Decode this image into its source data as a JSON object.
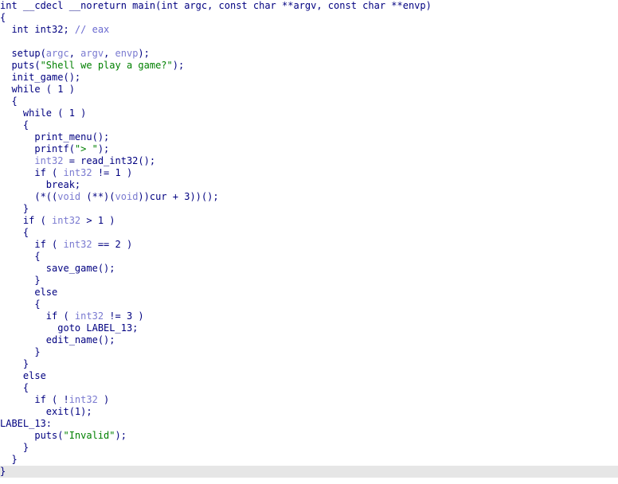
{
  "decompiler": {
    "lines": [
      [
        {
          "t": "int __cdecl __noreturn main(int argc, const char **argv, const char **envp)",
          "c": "code"
        }
      ],
      [
        {
          "t": "{",
          "c": "code"
        }
      ],
      [
        {
          "t": "  int int32; ",
          "c": "code"
        },
        {
          "t": "// eax",
          "c": "comment"
        }
      ],
      [
        {
          "t": "",
          "c": "code"
        }
      ],
      [
        {
          "t": "  setup(",
          "c": "code"
        },
        {
          "t": "argc",
          "c": "var"
        },
        {
          "t": ", ",
          "c": "code"
        },
        {
          "t": "argv",
          "c": "var"
        },
        {
          "t": ", ",
          "c": "code"
        },
        {
          "t": "envp",
          "c": "var"
        },
        {
          "t": ");",
          "c": "code"
        }
      ],
      [
        {
          "t": "  puts(",
          "c": "code"
        },
        {
          "t": "\"Shell we play a game?\"",
          "c": "string"
        },
        {
          "t": ");",
          "c": "code"
        }
      ],
      [
        {
          "t": "  init_game();",
          "c": "code"
        }
      ],
      [
        {
          "t": "  while ( 1 )",
          "c": "code"
        }
      ],
      [
        {
          "t": "  {",
          "c": "code"
        }
      ],
      [
        {
          "t": "    while ( 1 )",
          "c": "code"
        }
      ],
      [
        {
          "t": "    {",
          "c": "code"
        }
      ],
      [
        {
          "t": "      print_menu();",
          "c": "code"
        }
      ],
      [
        {
          "t": "      printf(",
          "c": "code"
        },
        {
          "t": "\"> \"",
          "c": "string"
        },
        {
          "t": ");",
          "c": "code"
        }
      ],
      [
        {
          "t": "      ",
          "c": "code"
        },
        {
          "t": "int32",
          "c": "var"
        },
        {
          "t": " = read_int32();",
          "c": "code"
        }
      ],
      [
        {
          "t": "      if ( ",
          "c": "code"
        },
        {
          "t": "int32",
          "c": "var"
        },
        {
          "t": " != 1 )",
          "c": "code"
        }
      ],
      [
        {
          "t": "        break;",
          "c": "code"
        }
      ],
      [
        {
          "t": "      (*((",
          "c": "code"
        },
        {
          "t": "void",
          "c": "var"
        },
        {
          "t": " (**)(",
          "c": "code"
        },
        {
          "t": "void",
          "c": "var"
        },
        {
          "t": "))cur + 3))();",
          "c": "code"
        }
      ],
      [
        {
          "t": "    }",
          "c": "code"
        }
      ],
      [
        {
          "t": "    if ( ",
          "c": "code"
        },
        {
          "t": "int32",
          "c": "var"
        },
        {
          "t": " > 1 )",
          "c": "code"
        }
      ],
      [
        {
          "t": "    {",
          "c": "code"
        }
      ],
      [
        {
          "t": "      if ( ",
          "c": "code"
        },
        {
          "t": "int32",
          "c": "var"
        },
        {
          "t": " == 2 )",
          "c": "code"
        }
      ],
      [
        {
          "t": "      {",
          "c": "code"
        }
      ],
      [
        {
          "t": "        save_game();",
          "c": "code"
        }
      ],
      [
        {
          "t": "      }",
          "c": "code"
        }
      ],
      [
        {
          "t": "      else",
          "c": "code"
        }
      ],
      [
        {
          "t": "      {",
          "c": "code"
        }
      ],
      [
        {
          "t": "        if ( ",
          "c": "code"
        },
        {
          "t": "int32",
          "c": "var"
        },
        {
          "t": " != 3 )",
          "c": "code"
        }
      ],
      [
        {
          "t": "          goto LABEL_13;",
          "c": "code"
        }
      ],
      [
        {
          "t": "        edit_name();",
          "c": "code"
        }
      ],
      [
        {
          "t": "      }",
          "c": "code"
        }
      ],
      [
        {
          "t": "    }",
          "c": "code"
        }
      ],
      [
        {
          "t": "    else",
          "c": "code"
        }
      ],
      [
        {
          "t": "    {",
          "c": "code"
        }
      ],
      [
        {
          "t": "      if ( !",
          "c": "code"
        },
        {
          "t": "int32",
          "c": "var"
        },
        {
          "t": " )",
          "c": "code"
        }
      ],
      [
        {
          "t": "        exit(1);",
          "c": "code"
        }
      ],
      [
        {
          "t": "LABEL_13:",
          "c": "label"
        }
      ],
      [
        {
          "t": "      puts(",
          "c": "code"
        },
        {
          "t": "\"Invalid\"",
          "c": "string"
        },
        {
          "t": ");",
          "c": "code"
        }
      ],
      [
        {
          "t": "    }",
          "c": "code"
        }
      ],
      [
        {
          "t": "  }",
          "c": "code"
        }
      ],
      [
        {
          "t": "}",
          "c": "code"
        }
      ]
    ],
    "highlighted_line_index": 39,
    "colors": {
      "code": "#000080",
      "var": "#7a7ad0",
      "comment": "#6a6ad0",
      "string": "#008000",
      "label": "#000080",
      "highlight_bg": "#e6e6e6"
    }
  }
}
